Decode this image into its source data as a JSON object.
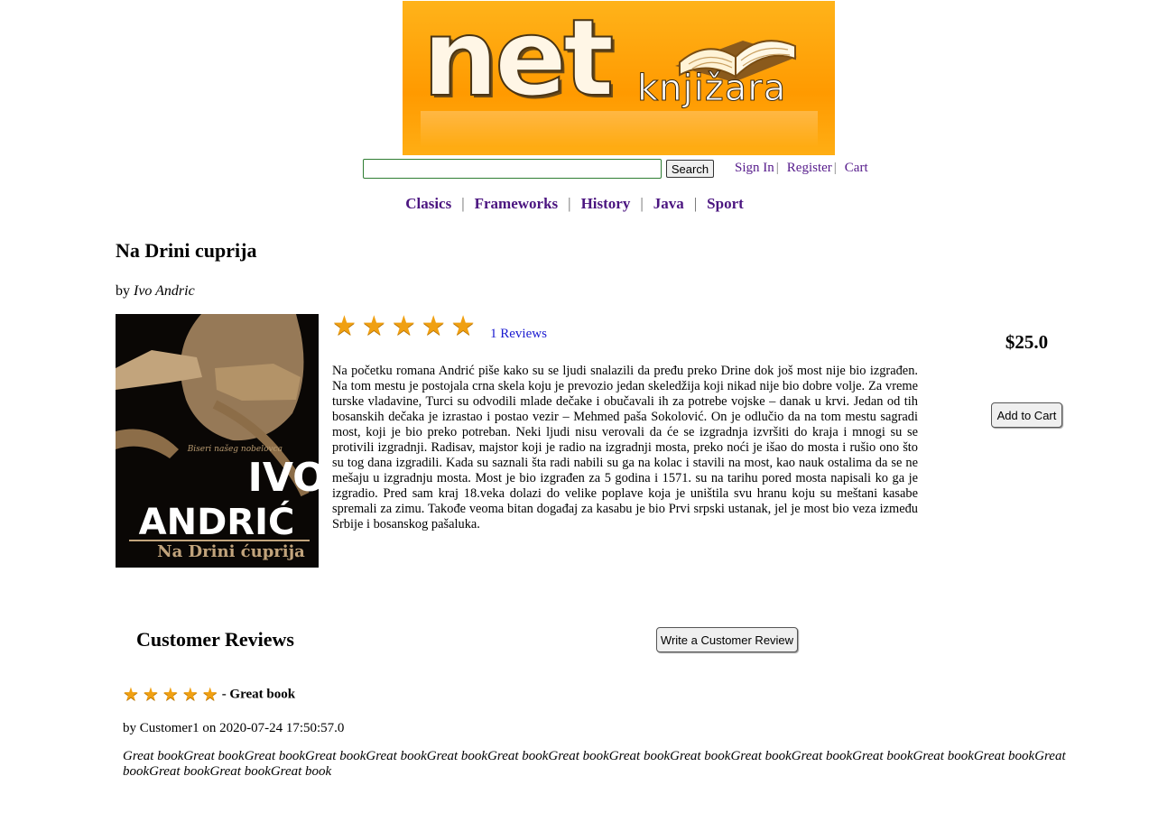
{
  "header": {
    "logo_main": "net",
    "logo_sub": "knjižara"
  },
  "search": {
    "value": "",
    "placeholder": "",
    "button_label": "Search"
  },
  "top_links": {
    "sign_in": "Sign In",
    "register": "Register",
    "cart": "Cart",
    "separator": "|"
  },
  "categories": [
    {
      "label": "Clasics"
    },
    {
      "label": "Frameworks"
    },
    {
      "label": "History"
    },
    {
      "label": "Java"
    },
    {
      "label": "Sport"
    }
  ],
  "book": {
    "title": "Na Drini cuprija",
    "by_prefix": "by",
    "author": "Ivo Andric",
    "cover": {
      "series": "Biseri našeg nobelovca",
      "author_first": "IVO",
      "author_last": "ANDRIĆ",
      "title": "Na Drini ćuprija"
    },
    "rating": 5,
    "reviews_link": "1 Reviews",
    "description": "Na početku romana Andrić piše kako su se ljudi snalazili da pređu preko Drine dok još most nije bio izgrađen. Na tom mestu je postojala crna skela koju je prevozio jedan skeledžija koji nikad nije bio dobre volje. Za vreme turske vladavine, Turci su odvodili mlade dečake i obučavali ih za potrebe vojske – danak u krvi. Jedan od tih bosanskih dečaka je izrastao i postao vezir – Mehmed paša Sokolović. On je odlučio da na tom mestu sagradi most, koji je bio preko potreban. Neki ljudi nisu verovali da će se izgradnja izvršiti do kraja i mnogi su se protivili izgradnji. Radisav, majstor koji je radio na izgradnji mosta, preko noći je išao do mosta i rušio ono što su tog dana izgradili. Kada su saznali šta radi nabili su ga na kolac i stavili na most, kao nauk ostalima da se ne mešaju u izgradnju mosta. Most je bio izgrađen za 5 godina i 1571. su na tarihu pored mosta napisali ko ga je izgradio. Pred sam kraj 18.veka dolazi do velike poplave koja je uništila svu hranu koju su meštani kasabe spremali za zimu. Takođe veoma bitan događaj za kasabu je bio Prvi srpski ustanak, jel je most bio veza između Srbije i bosanskog pašaluka.",
    "price": "$25.0",
    "add_to_cart_label": "Add to Cart"
  },
  "reviews": {
    "heading": "Customer Reviews",
    "write_button": "Write a Customer Review",
    "items": [
      {
        "rating": 5,
        "title": "- Great book",
        "by_prefix": "by",
        "author": "Customer1",
        "on_word": "on",
        "date": "2020-07-24 17:50:57.0",
        "body": "Great bookGreat bookGreat bookGreat bookGreat bookGreat bookGreat bookGreat bookGreat bookGreat bookGreat bookGreat bookGreat bookGreat bookGreat bookGreat bookGreat bookGreat bookGreat book"
      }
    ]
  },
  "colors": {
    "banner_orange": "#ff9a00",
    "link_purple": "#551a8b",
    "link_blue": "#1a1ad0",
    "star_gold": "#f0a012"
  }
}
